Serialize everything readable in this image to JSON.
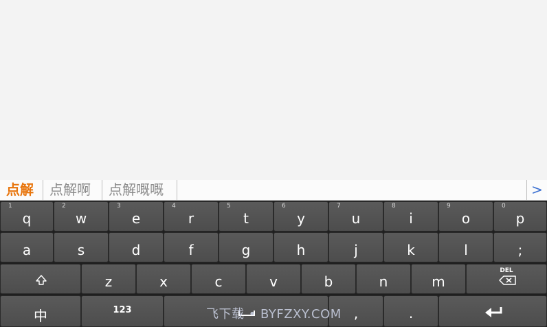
{
  "candidates": {
    "items": [
      {
        "text": "点解"
      },
      {
        "text": "点解啊"
      },
      {
        "text": "点解嘅嘅"
      }
    ],
    "more_label": ">"
  },
  "keyboard": {
    "row1": [
      {
        "label": "q",
        "hint": "1"
      },
      {
        "label": "w",
        "hint": "2"
      },
      {
        "label": "e",
        "hint": "3"
      },
      {
        "label": "r",
        "hint": "4"
      },
      {
        "label": "t",
        "hint": "5"
      },
      {
        "label": "y",
        "hint": "6"
      },
      {
        "label": "u",
        "hint": "7"
      },
      {
        "label": "i",
        "hint": "8"
      },
      {
        "label": "o",
        "hint": "9"
      },
      {
        "label": "p",
        "hint": "0"
      }
    ],
    "row2": [
      "a",
      "s",
      "d",
      "f",
      "g",
      "h",
      "j",
      "k",
      "l",
      ";"
    ],
    "row3": [
      "z",
      "x",
      "c",
      "v",
      "b",
      "n",
      "m"
    ],
    "shift_icon": "shift-icon",
    "delete_label": "DEL",
    "delete_icon": "backspace-icon",
    "lang_label": "中",
    "numbers_label": "123",
    "space_icon": "space-icon",
    "comma_label": ",",
    "period_label": ".",
    "enter_icon": "enter-icon"
  },
  "watermark": "飞下载 • BYFZXY.COM"
}
